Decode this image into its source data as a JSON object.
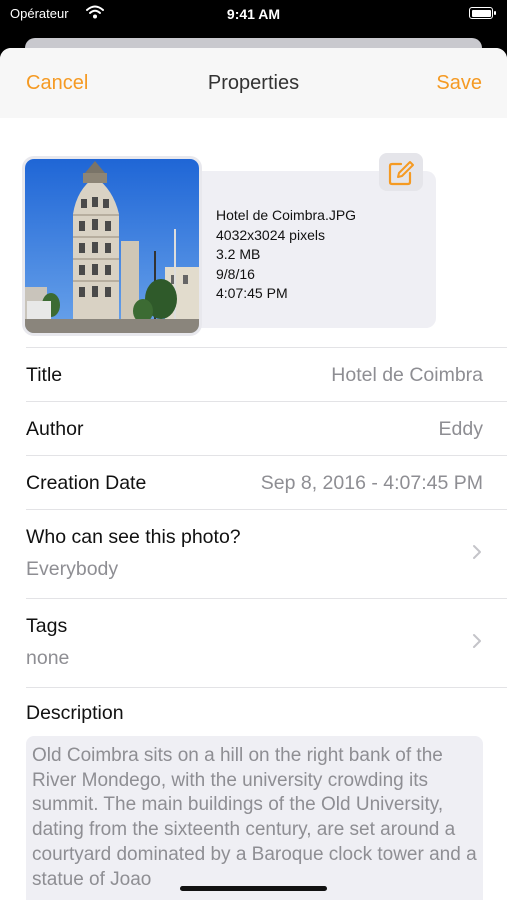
{
  "status_bar": {
    "carrier": "Opérateur",
    "time": "9:41 AM",
    "battery_level_pct": 100
  },
  "navbar": {
    "cancel_label": "Cancel",
    "title": "Properties",
    "save_label": "Save",
    "accent_color": "#f59a23"
  },
  "photo": {
    "filename": "Hotel de Coimbra.JPG",
    "dimensions": "4032x3024 pixels",
    "size": "3.2 MB",
    "date": "9/8/16",
    "time": "4:07:45 PM",
    "edit_icon": "edit-square-icon"
  },
  "fields": {
    "title": {
      "label": "Title",
      "value": "Hotel de Coimbra"
    },
    "author": {
      "label": "Author",
      "value": "Eddy"
    },
    "creation_date": {
      "label": "Creation Date",
      "value": "Sep 8, 2016 - 4:07:45 PM"
    },
    "visibility": {
      "label": "Who can see this photo?",
      "value": "Everybody"
    },
    "tags": {
      "label": "Tags",
      "value": "none"
    }
  },
  "description": {
    "label": "Description",
    "text": "Old Coimbra sits on a hill on the right bank of the River Mondego, with the university crowding its summit. The main buildings of the Old University, dating from the sixteenth century, are set around a courtyard dominated by a Baroque clock tower and a statue of Joao"
  }
}
